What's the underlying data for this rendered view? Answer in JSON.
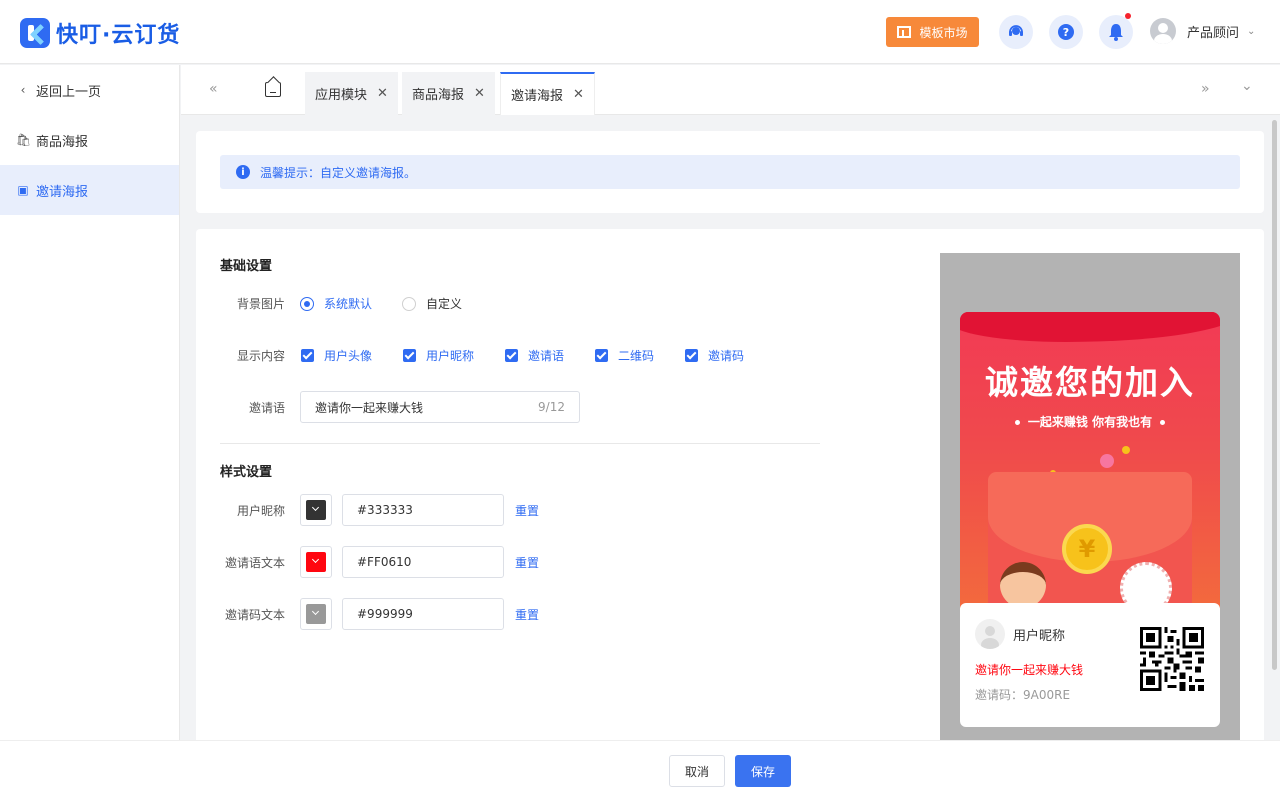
{
  "header": {
    "brand": "快叮·云订货",
    "template_market": "模板市场",
    "user_name": "产品顾问"
  },
  "sidebar": {
    "back": "返回上一页",
    "items": [
      {
        "label": "商品海报",
        "icon": "bag-icon"
      },
      {
        "label": "邀请海报",
        "icon": "image-icon"
      }
    ]
  },
  "tabs": [
    {
      "label": "应用模块"
    },
    {
      "label": "商品海报"
    },
    {
      "label": "邀请海报"
    }
  ],
  "tip": "温馨提示：自定义邀请海报。",
  "basic": {
    "title": "基础设置",
    "bg_label": "背景图片",
    "bg_options": [
      "系统默认",
      "自定义"
    ],
    "bg_selected": "系统默认",
    "display_label": "显示内容",
    "display_options": [
      "用户头像",
      "用户昵称",
      "邀请语",
      "二维码",
      "邀请码"
    ],
    "invite_label": "邀请语",
    "invite_value": "邀请你一起来赚大钱",
    "invite_count": "9/12"
  },
  "style": {
    "title": "样式设置",
    "rows": [
      {
        "label": "用户昵称",
        "color": "#333333",
        "reset": "重置"
      },
      {
        "label": "邀请语文本",
        "color": "#FF0610",
        "reset": "重置"
      },
      {
        "label": "邀请码文本",
        "color": "#999999",
        "reset": "重置"
      }
    ]
  },
  "preview": {
    "headline": "诚邀您的加入",
    "subline": "一起来赚钱 你有我也有",
    "coin": "¥",
    "nickname": "用户昵称",
    "invite_text": "邀请你一起来赚大钱",
    "code": "邀请码：9A00RE"
  },
  "footer": {
    "cancel": "取消",
    "save": "保存"
  }
}
